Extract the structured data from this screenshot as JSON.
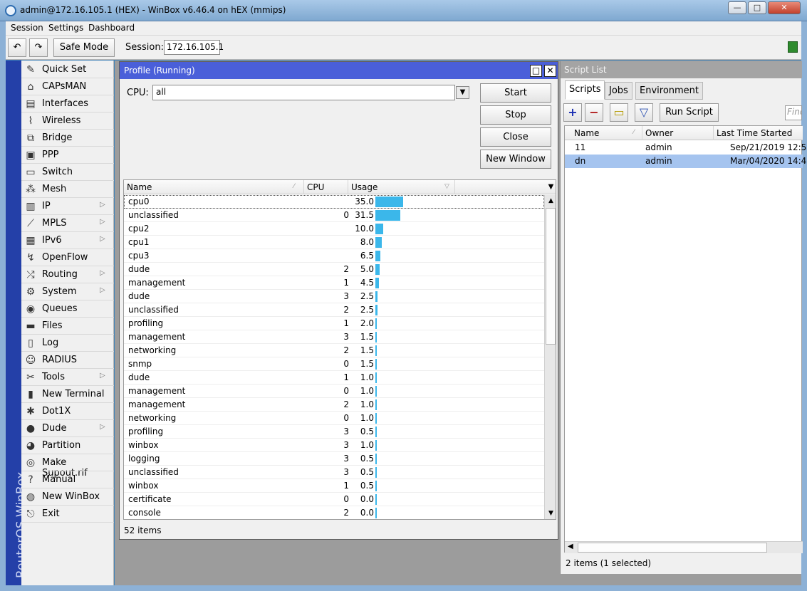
{
  "window": {
    "title": "admin@172.16.105.1 (HEX) - WinBox v6.46.4 on hEX (mmips)",
    "min": "—",
    "max": "□",
    "close": "✕"
  },
  "menu": {
    "session": "Session",
    "settings": "Settings",
    "dashboard": "Dashboard"
  },
  "toolbar": {
    "undo": "↶",
    "redo": "↷",
    "safe_mode": "Safe Mode",
    "session_label": "Session:",
    "session_value": "172.16.105.1"
  },
  "brand_vertical": "RouterOS WinBox",
  "sidebar": {
    "items": [
      {
        "label": "Quick Set",
        "icon": "quick-set-icon",
        "glyph": "✎",
        "arrow": ""
      },
      {
        "label": "CAPsMAN",
        "icon": "capsman-icon",
        "glyph": "⌂",
        "arrow": ""
      },
      {
        "label": "Interfaces",
        "icon": "interfaces-icon",
        "glyph": "▤",
        "arrow": ""
      },
      {
        "label": "Wireless",
        "icon": "wireless-icon",
        "glyph": "⌇",
        "arrow": ""
      },
      {
        "label": "Bridge",
        "icon": "bridge-icon",
        "glyph": "⧉",
        "arrow": ""
      },
      {
        "label": "PPP",
        "icon": "ppp-icon",
        "glyph": "▣",
        "arrow": ""
      },
      {
        "label": "Switch",
        "icon": "switch-icon",
        "glyph": "▭",
        "arrow": ""
      },
      {
        "label": "Mesh",
        "icon": "mesh-icon",
        "glyph": "⁂",
        "arrow": ""
      },
      {
        "label": "IP",
        "icon": "ip-icon",
        "glyph": "▥",
        "arrow": "▷"
      },
      {
        "label": "MPLS",
        "icon": "mpls-icon",
        "glyph": "⟋",
        "arrow": "▷"
      },
      {
        "label": "IPv6",
        "icon": "ipv6-icon",
        "glyph": "▦",
        "arrow": "▷"
      },
      {
        "label": "OpenFlow",
        "icon": "openflow-icon",
        "glyph": "↯",
        "arrow": ""
      },
      {
        "label": "Routing",
        "icon": "routing-icon",
        "glyph": "⤮",
        "arrow": "▷"
      },
      {
        "label": "System",
        "icon": "system-icon",
        "glyph": "⚙",
        "arrow": "▷"
      },
      {
        "label": "Queues",
        "icon": "queues-icon",
        "glyph": "◉",
        "arrow": ""
      },
      {
        "label": "Files",
        "icon": "files-icon",
        "glyph": "▬",
        "arrow": ""
      },
      {
        "label": "Log",
        "icon": "log-icon",
        "glyph": "▯",
        "arrow": ""
      },
      {
        "label": "RADIUS",
        "icon": "radius-icon",
        "glyph": "☺",
        "arrow": ""
      },
      {
        "label": "Tools",
        "icon": "tools-icon",
        "glyph": "✂",
        "arrow": "▷"
      },
      {
        "label": "New Terminal",
        "icon": "terminal-icon",
        "glyph": "▮",
        "arrow": ""
      },
      {
        "label": "Dot1X",
        "icon": "dot1x-icon",
        "glyph": "✱",
        "arrow": ""
      },
      {
        "label": "Dude",
        "icon": "dude-icon",
        "glyph": "●",
        "arrow": "▷"
      },
      {
        "label": "Partition",
        "icon": "partition-icon",
        "glyph": "◕",
        "arrow": ""
      },
      {
        "label": "Make Supout.rif",
        "icon": "supout-icon",
        "glyph": "◎",
        "arrow": ""
      },
      {
        "label": "Manual",
        "icon": "manual-icon",
        "glyph": "?",
        "arrow": ""
      },
      {
        "label": "New WinBox",
        "icon": "new-winbox-icon",
        "glyph": "◍",
        "arrow": ""
      },
      {
        "label": "Exit",
        "icon": "exit-icon",
        "glyph": "⎋",
        "arrow": ""
      }
    ]
  },
  "profile": {
    "title": "Profile (Running)",
    "restore": "□",
    "close": "✕",
    "cpu_label": "CPU:",
    "cpu_value": "all",
    "cpu_arrow": "▼",
    "buttons": {
      "start": "Start",
      "stop": "Stop",
      "close": "Close",
      "new_window": "New Window"
    },
    "columns": {
      "name": "Name",
      "cpu": "CPU",
      "usage": "Usage"
    },
    "header_dropdown": "▼",
    "scroll_up": "▲",
    "scroll_down": "▼",
    "rows": [
      {
        "name": "cpu0",
        "cpu": "",
        "usage": "35.0"
      },
      {
        "name": "unclassified",
        "cpu": "0",
        "usage": "31.5"
      },
      {
        "name": "cpu2",
        "cpu": "",
        "usage": "10.0"
      },
      {
        "name": "cpu1",
        "cpu": "",
        "usage": "8.0"
      },
      {
        "name": "cpu3",
        "cpu": "",
        "usage": "6.5"
      },
      {
        "name": "dude",
        "cpu": "2",
        "usage": "5.0"
      },
      {
        "name": "management",
        "cpu": "1",
        "usage": "4.5"
      },
      {
        "name": "dude",
        "cpu": "3",
        "usage": "2.5"
      },
      {
        "name": "unclassified",
        "cpu": "2",
        "usage": "2.5"
      },
      {
        "name": "profiling",
        "cpu": "1",
        "usage": "2.0"
      },
      {
        "name": "management",
        "cpu": "3",
        "usage": "1.5"
      },
      {
        "name": "networking",
        "cpu": "2",
        "usage": "1.5"
      },
      {
        "name": "snmp",
        "cpu": "0",
        "usage": "1.5"
      },
      {
        "name": "dude",
        "cpu": "1",
        "usage": "1.0"
      },
      {
        "name": "management",
        "cpu": "0",
        "usage": "1.0"
      },
      {
        "name": "management",
        "cpu": "2",
        "usage": "1.0"
      },
      {
        "name": "networking",
        "cpu": "0",
        "usage": "1.0"
      },
      {
        "name": "profiling",
        "cpu": "3",
        "usage": "0.5"
      },
      {
        "name": "winbox",
        "cpu": "3",
        "usage": "1.0"
      },
      {
        "name": "logging",
        "cpu": "3",
        "usage": "0.5"
      },
      {
        "name": "unclassified",
        "cpu": "3",
        "usage": "0.5"
      },
      {
        "name": "winbox",
        "cpu": "1",
        "usage": "0.5"
      },
      {
        "name": "certificate",
        "cpu": "0",
        "usage": "0.0"
      },
      {
        "name": "console",
        "cpu": "2",
        "usage": "0.0"
      }
    ],
    "items_count": "52 items"
  },
  "scripts": {
    "title": "Script List",
    "tabs": [
      "Scripts",
      "Jobs",
      "Environment"
    ],
    "add": "+",
    "remove": "−",
    "comment": "▭",
    "filter": "▽",
    "run_script": "Run Script",
    "find_placeholder": "Find",
    "columns": {
      "name": "Name",
      "owner": "Owner",
      "last_started": "Last Time Started"
    },
    "rows": [
      {
        "name": "11",
        "owner": "admin",
        "last_started": "Sep/21/2019 12:5",
        "selected": false
      },
      {
        "name": "dn",
        "owner": "admin",
        "last_started": "Mar/04/2020 14:4",
        "selected": true
      }
    ],
    "hscroll_left": "◀",
    "status": "2 items (1 selected)"
  },
  "colors": {
    "usage_bar": "#3bb7ea",
    "active_title": "#4a5fd9",
    "selected_row": "#a5c4ef",
    "brand_strip": "#2440a8"
  }
}
